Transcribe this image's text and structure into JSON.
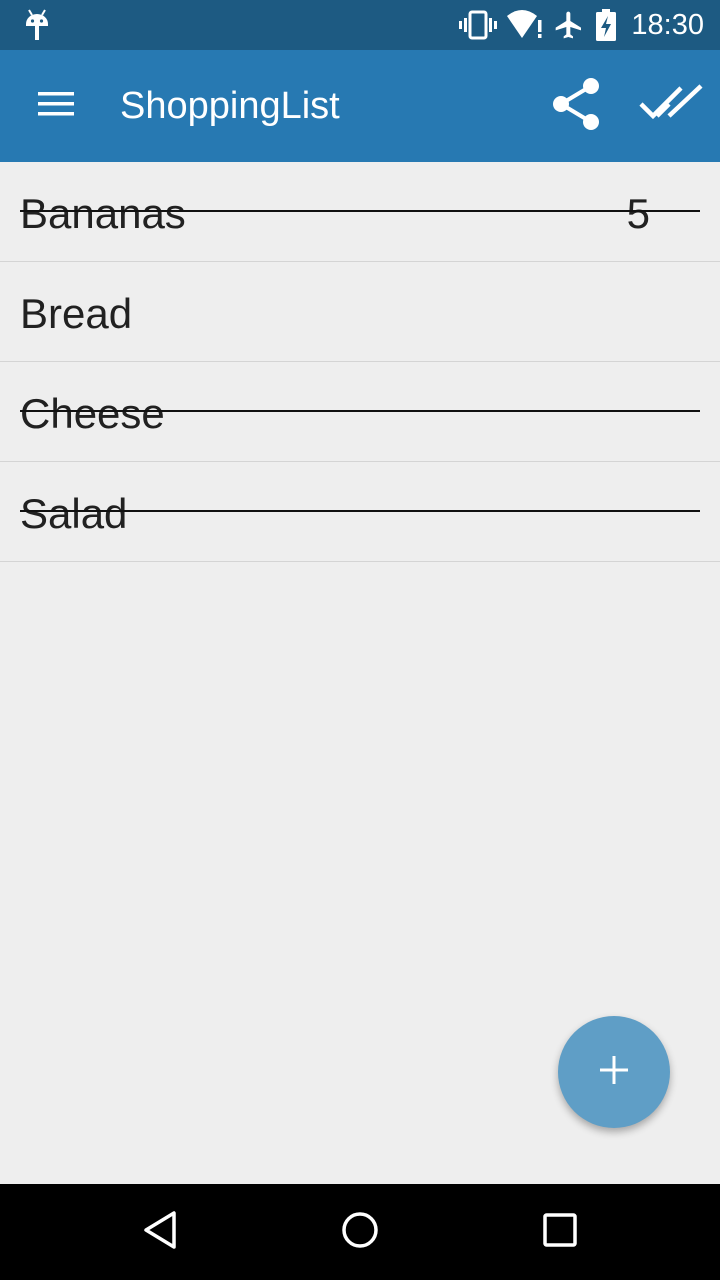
{
  "status_bar": {
    "time": "18:30",
    "icons": [
      "android-debug-icon",
      "vibrate-icon",
      "wifi-alert-icon",
      "airplane-icon",
      "battery-charging-icon"
    ]
  },
  "app_bar": {
    "title": "ShoppingList",
    "icons": [
      "menu-icon",
      "share-icon",
      "check-all-icon"
    ]
  },
  "list": {
    "items": [
      {
        "name": "Bananas",
        "quantity": "5",
        "checked": true
      },
      {
        "name": "Bread",
        "quantity": "",
        "checked": false
      },
      {
        "name": "Cheese",
        "quantity": "",
        "checked": true
      },
      {
        "name": "Salad",
        "quantity": "",
        "checked": true
      }
    ]
  },
  "fab": {
    "icon": "add-icon"
  },
  "nav_bar": {
    "icons": [
      "back-icon",
      "home-icon",
      "recents-icon"
    ]
  },
  "colors": {
    "status_bar": "#1d5a82",
    "app_bar": "#2779b2",
    "background": "#eeeeee",
    "fab": "#5f9ec6"
  }
}
